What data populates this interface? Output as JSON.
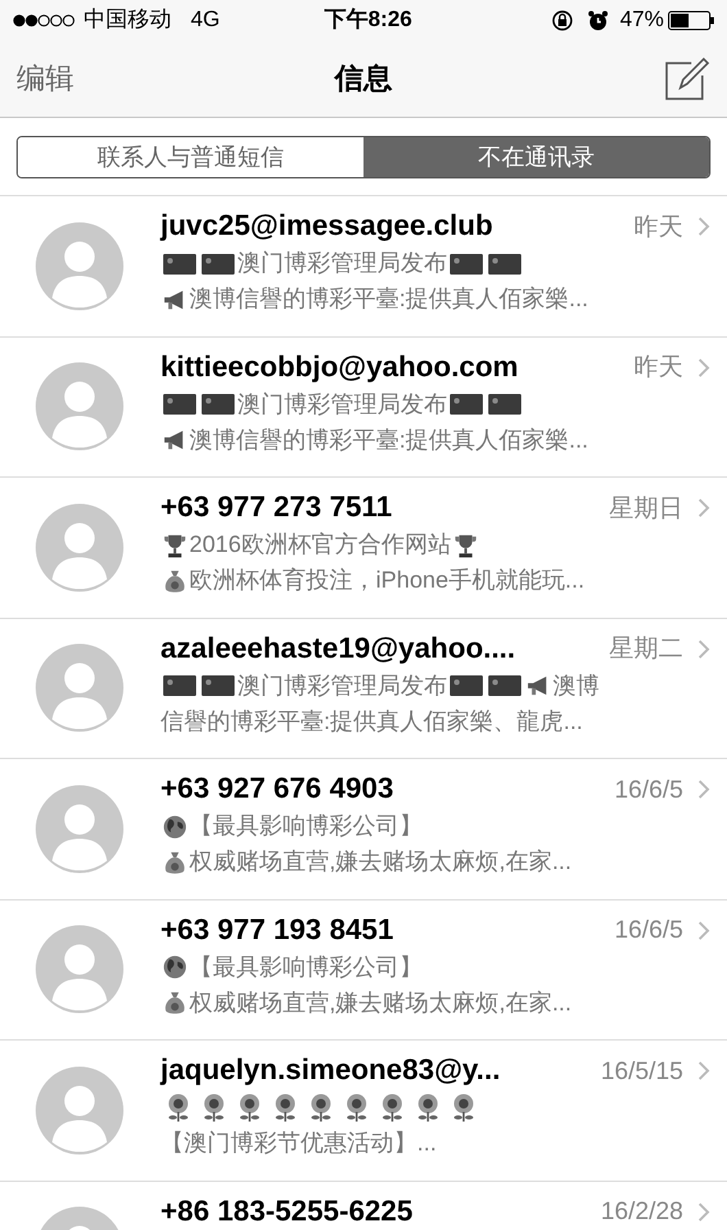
{
  "status_bar": {
    "carrier": "中国移动",
    "network": "4G",
    "time": "下午8:26",
    "battery": "47%"
  },
  "nav": {
    "edit": "编辑",
    "title": "信息"
  },
  "segments": [
    {
      "label": "联系人与普通短信",
      "selected": false
    },
    {
      "label": "不在通讯录",
      "selected": true
    }
  ],
  "conversations": [
    {
      "sender": "juvc25@imessagee.club",
      "time": "昨天",
      "lines": [
        [
          {
            "kind": "flag"
          },
          {
            "kind": "flag"
          },
          {
            "kind": "text",
            "text": "澳门博彩管理局发布"
          },
          {
            "kind": "flag"
          },
          {
            "kind": "flag"
          }
        ],
        [
          {
            "kind": "megaphone"
          },
          {
            "kind": "text",
            "text": "澳博信譽的博彩平臺:提供真人佰家樂..."
          }
        ]
      ]
    },
    {
      "sender": "kittieecobbjo@yahoo.com",
      "time": "昨天",
      "lines": [
        [
          {
            "kind": "flag"
          },
          {
            "kind": "flag"
          },
          {
            "kind": "text",
            "text": "澳门博彩管理局发布"
          },
          {
            "kind": "flag"
          },
          {
            "kind": "flag"
          }
        ],
        [
          {
            "kind": "megaphone"
          },
          {
            "kind": "text",
            "text": "澳博信譽的博彩平臺:提供真人佰家樂..."
          }
        ]
      ]
    },
    {
      "sender": "+63 977 273 7511",
      "time": "星期日",
      "lines": [
        [
          {
            "kind": "trophy"
          },
          {
            "kind": "text",
            "text": "2016欧洲杯官方合作网站"
          },
          {
            "kind": "trophy"
          }
        ],
        [
          {
            "kind": "money-bag"
          },
          {
            "kind": "text",
            "text": "欧洲杯体育投注，iPhone手机就能玩..."
          }
        ]
      ]
    },
    {
      "sender": "azaleeehaste19@yahoo....",
      "time": "星期二",
      "lines": [
        [
          {
            "kind": "flag"
          },
          {
            "kind": "flag"
          },
          {
            "kind": "text",
            "text": "澳门博彩管理局发布"
          },
          {
            "kind": "flag"
          },
          {
            "kind": "flag"
          },
          {
            "kind": "megaphone"
          },
          {
            "kind": "text",
            "text": "澳博"
          }
        ],
        [
          {
            "kind": "text",
            "text": "信譽的博彩平臺:提供真人佰家樂、龍虎..."
          }
        ]
      ]
    },
    {
      "sender": "+63 927 676 4903",
      "time": "16/6/5",
      "lines": [
        [
          {
            "kind": "globe"
          },
          {
            "kind": "text",
            "text": "【最具影响博彩公司】"
          }
        ],
        [
          {
            "kind": "money-bag"
          },
          {
            "kind": "text",
            "text": "权威赌场直营,嫌去赌场太麻烦,在家..."
          }
        ]
      ]
    },
    {
      "sender": "+63 977 193 8451",
      "time": "16/6/5",
      "lines": [
        [
          {
            "kind": "globe"
          },
          {
            "kind": "text",
            "text": "【最具影响博彩公司】"
          }
        ],
        [
          {
            "kind": "money-bag"
          },
          {
            "kind": "text",
            "text": "权威赌场直营,嫌去赌场太麻烦,在家..."
          }
        ]
      ]
    },
    {
      "sender": "jaquelyn.simeone83@y...",
      "time": "16/5/15",
      "lines": [
        [
          {
            "kind": "sunflower"
          },
          {
            "kind": "sunflower"
          },
          {
            "kind": "sunflower"
          },
          {
            "kind": "sunflower"
          },
          {
            "kind": "sunflower"
          },
          {
            "kind": "sunflower"
          },
          {
            "kind": "sunflower"
          },
          {
            "kind": "sunflower"
          },
          {
            "kind": "sunflower"
          }
        ],
        [
          {
            "kind": "text",
            "text": "【澳门博彩节优惠活动】..."
          }
        ]
      ]
    },
    {
      "sender": "+86 183-5255-6225",
      "time": "16/2/28"
    }
  ]
}
